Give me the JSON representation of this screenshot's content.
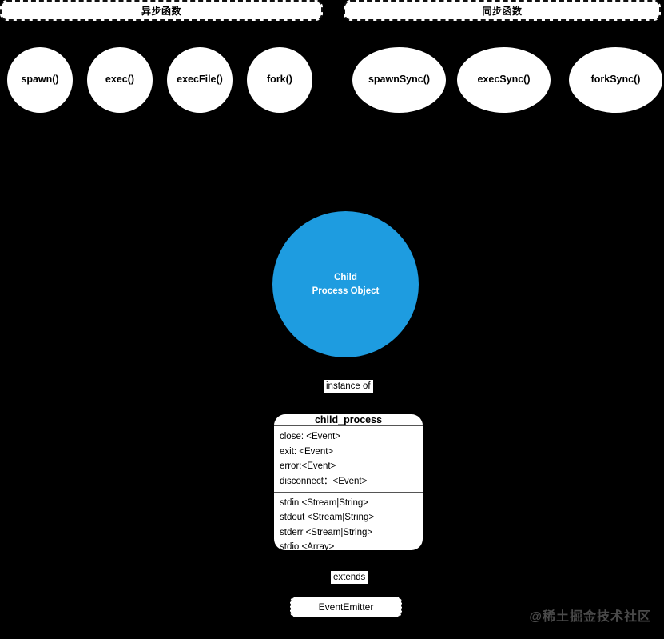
{
  "diagram": {
    "background_color": "#000000",
    "groups": [
      {
        "id": "async",
        "label": "异步函数"
      },
      {
        "id": "sync",
        "label": "同步函数"
      }
    ],
    "async_functions": [
      {
        "label": "spawn()"
      },
      {
        "label": "exec()"
      },
      {
        "label": "execFile()"
      },
      {
        "label": "fork()"
      }
    ],
    "sync_functions": [
      {
        "label": "spawnSync()"
      },
      {
        "label": "execSync()"
      },
      {
        "label": "forkSync()"
      }
    ],
    "central_node": {
      "line1": "Child",
      "line2": "Process Object",
      "color": "#1e9ce0"
    },
    "edges": [
      {
        "label": "instance of"
      },
      {
        "label": "extends"
      }
    ],
    "class_box": {
      "title": "child_process",
      "events": [
        "close: <Event>",
        "exit: <Event>",
        "error:<Event>",
        "disconnect：<Event>"
      ],
      "properties": [
        "stdin <Stream|String>",
        "stdout <Stream|String>",
        "stderr <Stream|String>",
        "stdio <Array>"
      ]
    },
    "base_class": {
      "label": "EventEmitter"
    },
    "watermark": {
      "text": "@稀土掘金技术社区"
    }
  }
}
